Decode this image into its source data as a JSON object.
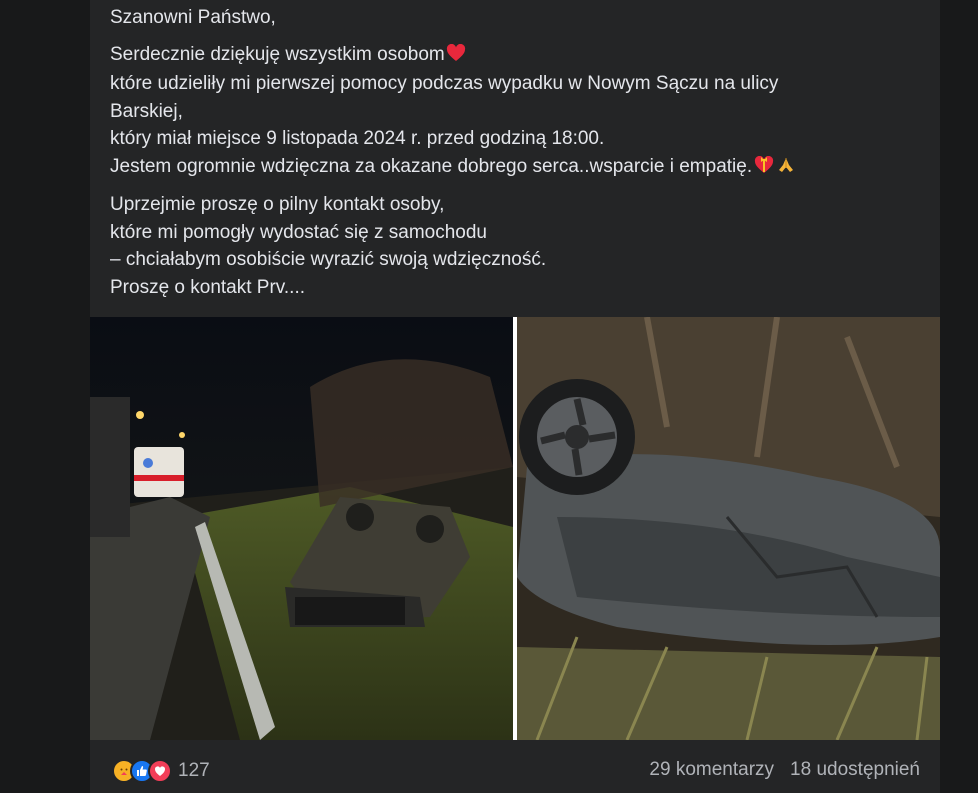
{
  "post": {
    "paragraphs": [
      {
        "lines": [
          {
            "text": "Szanowni Państwo,"
          }
        ]
      },
      {
        "lines": [
          {
            "text": "Serdecznie dziękuję wszystkim osobom",
            "emoji": "heart"
          },
          {
            "text": "które udzieliły mi pierwszej pomocy podczas wypadku w Nowym Sączu na ulicy"
          },
          {
            "text": "Barskiej,"
          },
          {
            "text": "który miał miejsce 9 listopada 2024 r. przed godziną 18:00."
          },
          {
            "text": "Jestem ogromnie wdzięczna za okazane dobrego serca..wsparcie i empatię.",
            "emoji": "heart-gift-pray"
          }
        ]
      },
      {
        "lines": [
          {
            "text": "Uprzejmie proszę o pilny kontakt osoby,"
          },
          {
            "text": "które mi pomogły wydostać się z samochodu"
          },
          {
            "text": "– chciałabym osobiście wyrazić swoją wdzięczność."
          },
          {
            "text": "Proszę o kontakt  Prv...."
          }
        ]
      }
    ]
  },
  "photos": [
    {
      "name": "accident-photo-road",
      "icon": "overturned-car-roadside"
    },
    {
      "name": "accident-photo-closeup",
      "icon": "overturned-car-closeup"
    }
  ],
  "reactions": {
    "icons": [
      "care-icon",
      "like-icon",
      "love-icon"
    ],
    "count": "127"
  },
  "stats": {
    "comments": "29 komentarzy",
    "shares": "18 udostępnień"
  },
  "colors": {
    "background": "#18191a",
    "card": "#242526",
    "text": "#e4e6eb",
    "secondary_text": "#b0b3b8",
    "like_blue": "#1877f2",
    "love_red": "#f33e58",
    "care_yellow": "#f7b125"
  }
}
